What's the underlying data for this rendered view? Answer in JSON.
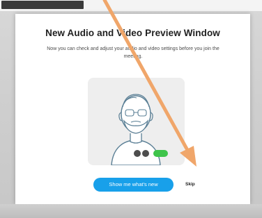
{
  "dialog": {
    "title": "New Audio and Video Preview Window",
    "subtitle": "Now you can check and adjust your audio and video settings before you join the meeting."
  },
  "actions": {
    "primary_label": "Show me what's new",
    "skip_label": "Skip"
  },
  "colors": {
    "accent": "#18a0ea",
    "toggle_on": "#3ec44a",
    "control_dots": "#4d4d4d",
    "arrow": "#f0a66a"
  },
  "icons": {
    "preview_illustration": "user-avatar-illustration",
    "annotation": "pointer-arrow"
  }
}
